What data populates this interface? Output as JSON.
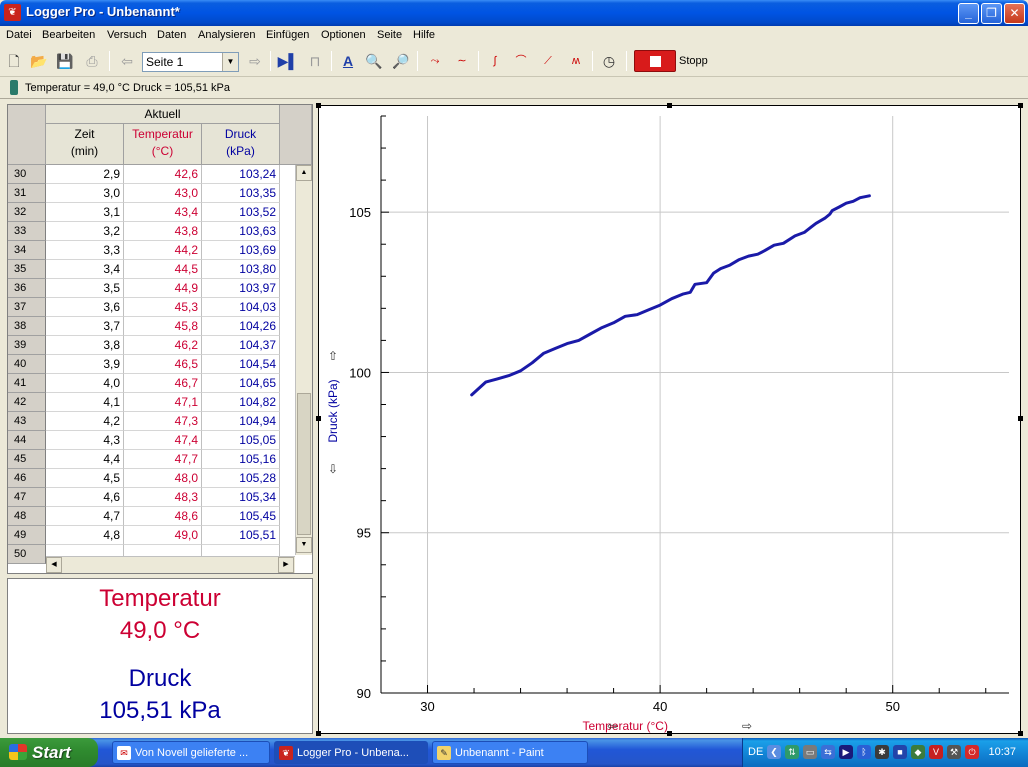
{
  "window": {
    "title": "Logger Pro - Unbenannt*"
  },
  "menu": [
    "Datei",
    "Bearbeiten",
    "Versuch",
    "Daten",
    "Analysieren",
    "Einfügen",
    "Optionen",
    "Seite",
    "Hilfe"
  ],
  "toolbar": {
    "page_select": "Seite 1",
    "stop_label": "Stopp"
  },
  "status": {
    "readout": "Temperatur = 49,0 °C  Druck = 105,51 kPa"
  },
  "table": {
    "group_header": "Aktuell",
    "columns": [
      {
        "name": "Zeit",
        "unit": "(min)"
      },
      {
        "name": "Temperatur",
        "unit": "(°C)"
      },
      {
        "name": "Druck",
        "unit": "(kPa)"
      }
    ],
    "rows": [
      {
        "n": "30",
        "zeit": "2,9",
        "temp": "42,6",
        "druck": "103,24"
      },
      {
        "n": "31",
        "zeit": "3,0",
        "temp": "43,0",
        "druck": "103,35"
      },
      {
        "n": "32",
        "zeit": "3,1",
        "temp": "43,4",
        "druck": "103,52"
      },
      {
        "n": "33",
        "zeit": "3,2",
        "temp": "43,8",
        "druck": "103,63"
      },
      {
        "n": "34",
        "zeit": "3,3",
        "temp": "44,2",
        "druck": "103,69"
      },
      {
        "n": "35",
        "zeit": "3,4",
        "temp": "44,5",
        "druck": "103,80"
      },
      {
        "n": "36",
        "zeit": "3,5",
        "temp": "44,9",
        "druck": "103,97"
      },
      {
        "n": "37",
        "zeit": "3,6",
        "temp": "45,3",
        "druck": "104,03"
      },
      {
        "n": "38",
        "zeit": "3,7",
        "temp": "45,8",
        "druck": "104,26"
      },
      {
        "n": "39",
        "zeit": "3,8",
        "temp": "46,2",
        "druck": "104,37"
      },
      {
        "n": "40",
        "zeit": "3,9",
        "temp": "46,5",
        "druck": "104,54"
      },
      {
        "n": "41",
        "zeit": "4,0",
        "temp": "46,7",
        "druck": "104,65"
      },
      {
        "n": "42",
        "zeit": "4,1",
        "temp": "47,1",
        "druck": "104,82"
      },
      {
        "n": "43",
        "zeit": "4,2",
        "temp": "47,3",
        "druck": "104,94"
      },
      {
        "n": "44",
        "zeit": "4,3",
        "temp": "47,4",
        "druck": "105,05"
      },
      {
        "n": "45",
        "zeit": "4,4",
        "temp": "47,7",
        "druck": "105,16"
      },
      {
        "n": "46",
        "zeit": "4,5",
        "temp": "48,0",
        "druck": "105,28"
      },
      {
        "n": "47",
        "zeit": "4,6",
        "temp": "48,3",
        "druck": "105,34"
      },
      {
        "n": "48",
        "zeit": "4,7",
        "temp": "48,6",
        "druck": "105,45"
      },
      {
        "n": "49",
        "zeit": "4,8",
        "temp": "49,0",
        "druck": "105,51"
      },
      {
        "n": "50",
        "zeit": "",
        "temp": "",
        "druck": ""
      }
    ]
  },
  "meters": {
    "temp_label": "Temperatur",
    "temp_value": "49,0 °C",
    "druck_label": "Druck",
    "druck_value": "105,51 kPa"
  },
  "colors": {
    "temperature": "#cc0033",
    "pressure": "#0000a0",
    "line": "#1a1aa8"
  },
  "chart_data": {
    "type": "line",
    "xlabel": "Temperatur (°C)",
    "ylabel": "Druck (kPa)",
    "xlim": [
      28,
      55
    ],
    "ylim": [
      90,
      108
    ],
    "xticks": [
      30,
      40,
      50
    ],
    "yticks": [
      90,
      95,
      100,
      105
    ],
    "grid": true,
    "series": [
      {
        "x": [
          31.9,
          32.5,
          33.0,
          33.5,
          34.0,
          34.5,
          35.0,
          35.5,
          36.0,
          36.5,
          37.0,
          37.5,
          38.0,
          38.5,
          39.0,
          39.5,
          40.0,
          40.5,
          41.0,
          41.3,
          41.5,
          42.0,
          42.3,
          42.6,
          43.0,
          43.4,
          43.8,
          44.2,
          44.5,
          44.9,
          45.3,
          45.8,
          46.2,
          46.5,
          46.7,
          47.1,
          47.3,
          47.4,
          47.7,
          48.0,
          48.3,
          48.6,
          49.0
        ],
        "y": [
          99.3,
          99.7,
          99.8,
          99.9,
          100.05,
          100.3,
          100.6,
          100.75,
          100.9,
          101.0,
          101.2,
          101.4,
          101.55,
          101.75,
          101.8,
          101.95,
          102.1,
          102.3,
          102.45,
          102.5,
          102.75,
          102.8,
          103.1,
          103.24,
          103.35,
          103.52,
          103.63,
          103.69,
          103.8,
          103.97,
          104.03,
          104.26,
          104.37,
          104.54,
          104.65,
          104.82,
          104.94,
          105.05,
          105.16,
          105.28,
          105.34,
          105.45,
          105.51
        ]
      }
    ]
  }
}
